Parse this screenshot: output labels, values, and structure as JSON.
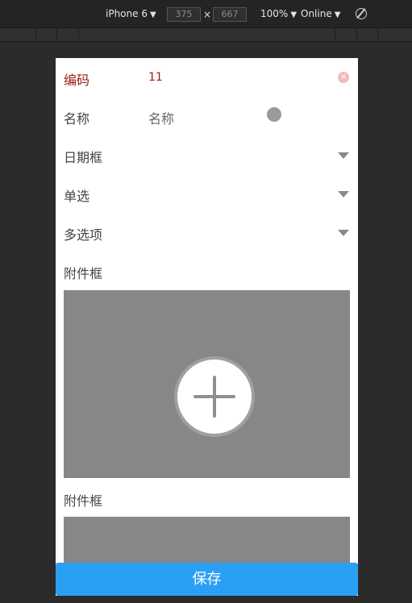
{
  "devtools": {
    "device": "iPhone 6",
    "width": "375",
    "times": "×",
    "height": "667",
    "zoom": "100%",
    "network": "Online",
    "dropdown_glyph": "▼"
  },
  "form": {
    "code": {
      "label": "编码",
      "value": "11",
      "clear_glyph": "×"
    },
    "name": {
      "label": "名称",
      "value": "名称"
    },
    "date": {
      "label": "日期框"
    },
    "single": {
      "label": "单选"
    },
    "multi": {
      "label": "多选项"
    },
    "attachment1": {
      "label": "附件框"
    },
    "attachment2": {
      "label": "附件框"
    }
  },
  "actions": {
    "save": "保存"
  },
  "colors": {
    "accent": "#2aa0f5",
    "error_text": "#9a1b1b",
    "clear_icon": "#f4b9b9",
    "upload_bg": "#878787"
  },
  "icons": {
    "clear": "clear-icon",
    "dropdown": "chevron-down-icon",
    "add": "plus-icon",
    "rotate": "rotate-icon"
  }
}
